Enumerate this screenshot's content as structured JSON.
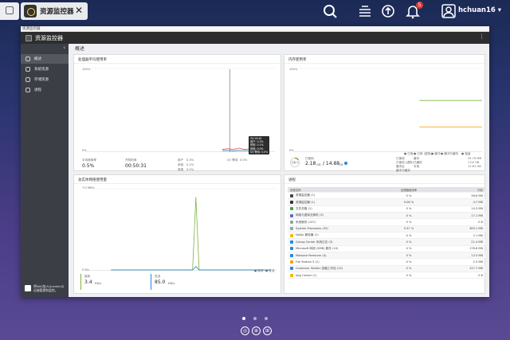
{
  "topbar": {
    "tab_title": "资源监控器",
    "tab_close": "✕",
    "notification_count": "5",
    "user_name": "hchuan16 ▾"
  },
  "window": {
    "titlebar": "资源监控器",
    "title": "资源监控器",
    "more": "⋮"
  },
  "sidebar": {
    "collapse": "‹",
    "items": [
      {
        "label": "概述"
      },
      {
        "label": "系统资源"
      },
      {
        "label": "存储资源"
      },
      {
        "label": "进程"
      }
    ],
    "notice": "将NAS加入Qcenter以远端管理和监控。"
  },
  "main": {
    "title": "概述"
  },
  "cpu_card": {
    "title": "处理器平均使用率",
    "y_max": "100%",
    "y_min": "0%",
    "avg_label": "平均使用率",
    "avg_value": "0.5%",
    "uptime_label": "开机时间",
    "uptime_value": "00:50:31",
    "stats": [
      {
        "k": "用户",
        "v": "0.3%"
      },
      {
        "k": "系统",
        "v": "0.2%"
      },
      {
        "k": "其他",
        "v": "0.0%"
      },
      {
        "k": "I/O 等待",
        "v": "0.0%"
      }
    ],
    "tooltip": [
      "20:19:40",
      "用户: 0.3%",
      "系统: 0.1%",
      "其他: 0.0%",
      "I/O 等待: 0.0%"
    ],
    "legend": [
      "● 用户",
      "● 系统",
      "● 其他",
      "● I/O 等待"
    ],
    "chart_data": {
      "type": "line",
      "ylim": [
        0,
        100
      ],
      "y_ticks": [
        "0%",
        "100%"
      ],
      "spike_x": 0.76,
      "series": [
        {
          "name": "用户",
          "color": "#e53935",
          "values": [
            0.3,
            0.4,
            0.3,
            0.5,
            0.3,
            0.4,
            0.3,
            0.3
          ]
        },
        {
          "name": "系统",
          "color": "#1e88e5",
          "values": [
            0.2,
            0.2,
            0.1,
            0.2,
            0.2,
            0.1,
            0.2,
            0.2
          ]
        },
        {
          "name": "其他",
          "color": "#ffb300",
          "values": [
            0.0,
            0.0,
            0.0,
            0.0,
            0.0,
            0.0,
            0.0,
            0.0
          ]
        },
        {
          "name": "I/O 等待",
          "color": "#9e9e9e",
          "values": [
            0.0,
            0.0,
            0.0,
            0.0,
            0.0,
            0.0,
            0.0,
            0.0
          ]
        }
      ]
    }
  },
  "mem_card": {
    "title": "内存使用率",
    "y_max": "100%",
    "y_min": "0%",
    "legend": [
      "● 已用",
      "● 已用 (虚拟)",
      "● 缓冲",
      "● 缓冲与缓存",
      "● 保留"
    ],
    "gauge_label": "已用 %",
    "gauge_fraction": 0.15,
    "used_label": "已使用",
    "used_value": "2.18",
    "used_unit": "GB",
    "total_value": "/ 14.88",
    "total_unit": "GB",
    "stats_left": [
      "已使用",
      "已使用 (虚拟)",
      "缓冲区",
      "缓冲与缓存"
    ],
    "stats_right": [
      {
        "k": "缓冲",
        "v": "25.74 MB"
      },
      {
        "k": "已缓存",
        "v": "1.02 GB"
      },
      {
        "k": "可用",
        "v": "11.61 GB"
      }
    ],
    "chart_data": {
      "type": "line",
      "ylim": [
        0,
        100
      ],
      "series": [
        {
          "name": "已用",
          "color": "#7cb342",
          "values": [
            null,
            null,
            null,
            null,
            null,
            null,
            14.6,
            14.6,
            14.6,
            14.6
          ]
        },
        {
          "name": "缓冲与缓存",
          "color": "#ff9800",
          "values": [
            null,
            null,
            null,
            null,
            null,
            null,
            7.0,
            7.0,
            7.0,
            7.0
          ]
        }
      ]
    }
  },
  "net_card": {
    "title": "总实体网络使用量",
    "y_max": "7.0 MB/s",
    "y_min": "0 B/s",
    "legend": [
      "● 接收",
      "● 发送"
    ],
    "recv_label": "接收",
    "recv_value": "3.4",
    "recv_unit": "KB/s",
    "send_label": "发送",
    "send_value": "85.0",
    "send_unit": "KB/s",
    "chart_data": {
      "type": "line",
      "ylim": [
        0,
        7.0
      ],
      "series": [
        {
          "name": "接收",
          "color": "#7cb342",
          "values": [
            0,
            0,
            0,
            0,
            0,
            0,
            0,
            0,
            0,
            0,
            0,
            0,
            0,
            0,
            0,
            0,
            0,
            0,
            0,
            0,
            0,
            0,
            0,
            0,
            0,
            0,
            6.4,
            0,
            0,
            0,
            0,
            0,
            0,
            0,
            0,
            0,
            0,
            0,
            0,
            0,
            0,
            0,
            0,
            0,
            0,
            0,
            0,
            0,
            0,
            0
          ]
        },
        {
          "name": "发送",
          "color": "#1e88e5",
          "values": [
            0,
            0,
            0,
            0,
            0,
            0,
            0,
            0,
            0,
            0,
            0,
            0,
            0,
            0,
            0,
            0,
            0,
            0,
            0,
            0,
            0,
            0,
            0,
            0,
            0,
            0,
            0.3,
            0,
            0,
            0,
            0,
            0,
            0,
            0,
            0,
            0,
            0,
            0,
            0,
            0,
            0,
            0,
            0,
            0,
            0,
            0,
            0,
            0,
            0,
            0
          ]
        }
      ]
    }
  },
  "process_card": {
    "title": "进程",
    "columns": [
      "进程名称",
      "处理器使用率",
      "内存"
    ],
    "rows": [
      {
        "name": "资源监控器 (1)",
        "cpu": "0 %",
        "mem": "38.8 MB",
        "color": "#444"
      },
      {
        "name": "资源监控器 (1)",
        "cpu": "0.06 %",
        "mem": "4.7 MB",
        "color": "#333"
      },
      {
        "name": "文件总管 (1)",
        "cpu": "0 %",
        "mem": "14.3 MB",
        "color": "#43a047"
      },
      {
        "name": "网络与虚拟交换机 (3)",
        "cpu": "0 %",
        "mem": "17.1 MB",
        "color": "#5c6bc0"
      },
      {
        "name": "系统服务 (147)",
        "cpu": "0 %",
        "mem": "0 B",
        "color": "#90a4ae"
      },
      {
        "name": "System Processes (39)",
        "cpu": "0.37 %",
        "mem": "383.1 MB",
        "color": "#90a4ae"
      },
      {
        "name": "NoSql 服务器 (1)",
        "cpu": "0 %",
        "mem": "2.1 MB",
        "color": "#ffb300"
      },
      {
        "name": "QuLog Center 系统日志 (3)",
        "cpu": "0 %",
        "mem": "21.4 MB",
        "color": "#1e88e5"
      },
      {
        "name": "Microsoft 网络 (SMB) 服务 (10)",
        "cpu": "0 %",
        "mem": "178.6 MB",
        "color": "#1e88e5"
      },
      {
        "name": "Malware Remover (4)",
        "cpu": "0 %",
        "mem": "13.3 MB",
        "color": "#1e88e5"
      },
      {
        "name": "File Station 5 (1)",
        "cpu": "0 %",
        "mem": "2.5 MB",
        "color": "#ffa000"
      },
      {
        "name": "Container Station 容器工作站 (13)",
        "cpu": "0 %",
        "mem": "127.7 MB",
        "color": "#1e88e5"
      },
      {
        "name": "App Center (1)",
        "cpu": "0 %",
        "mem": "0 B",
        "color": "#ffb300"
      }
    ]
  },
  "dock": {
    "buttons": [
      "◎",
      "⊕",
      "⊞"
    ]
  },
  "icons": {
    "search": "search-icon",
    "tasks": "task-stack-icon",
    "sync": "sync-icon",
    "bell": "bell-icon",
    "user": "user-icon"
  },
  "colors": {
    "sidebar_bg": "#3b3f45",
    "header_bg": "#2d2d2d",
    "accent_green": "#7cb342",
    "accent_blue": "#1e88e5"
  }
}
